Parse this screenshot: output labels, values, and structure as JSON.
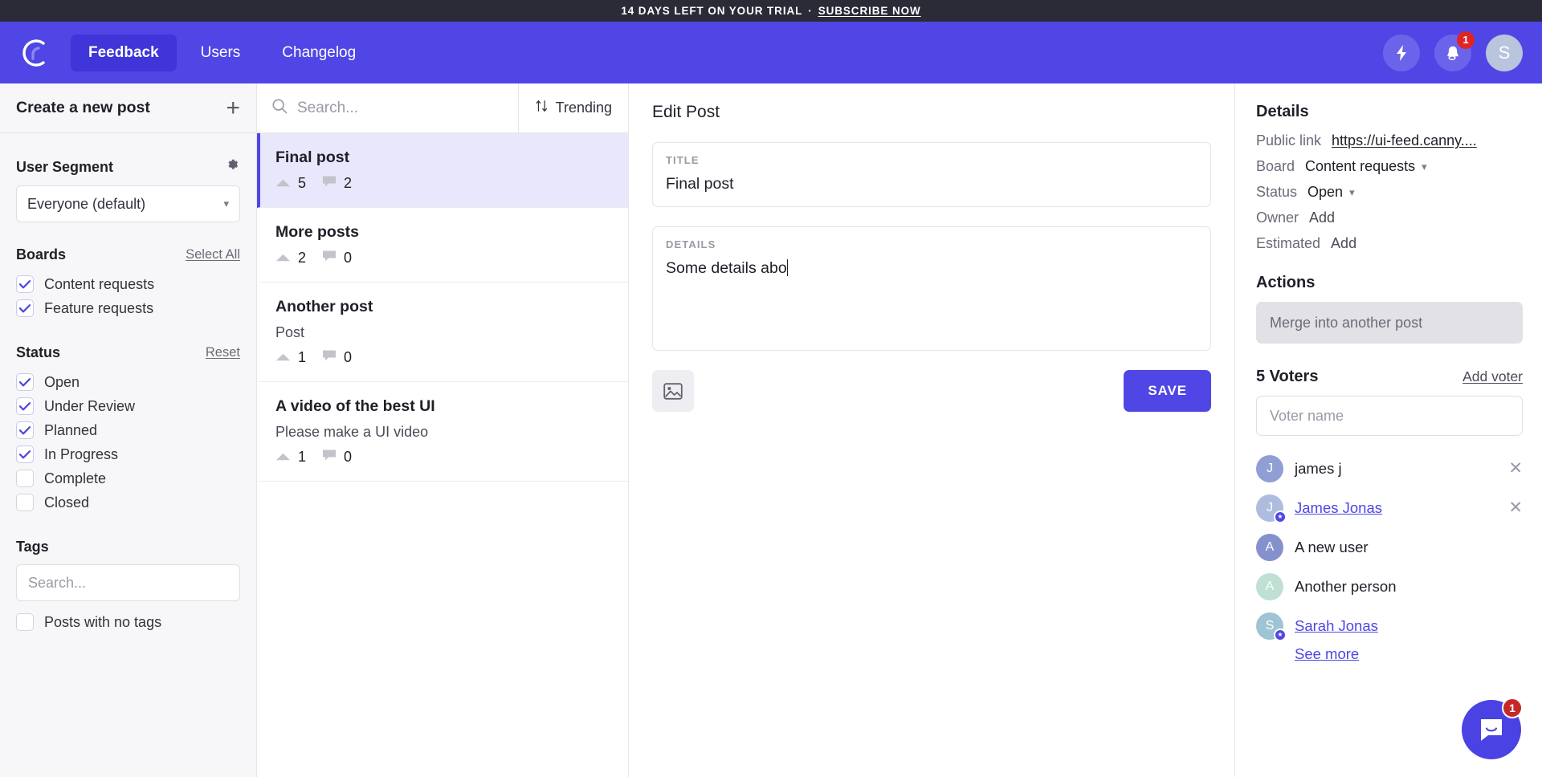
{
  "banner": {
    "text": "14 DAYS LEFT ON YOUR TRIAL",
    "separator": "·",
    "cta": "SUBSCRIBE NOW"
  },
  "topnav": {
    "logo_letter": "C",
    "links": [
      {
        "label": "Feedback",
        "active": true
      },
      {
        "label": "Users",
        "active": false
      },
      {
        "label": "Changelog",
        "active": false
      }
    ],
    "bolt_icon": "bolt-icon",
    "bell_icon": "bell-icon",
    "notification_count": "1",
    "avatar_initial": "S"
  },
  "sidebar": {
    "create_post": "Create a new post",
    "plus_icon": "plus-icon",
    "user_segment": {
      "title": "User Segment",
      "gear_icon": "gear-icon",
      "selected": "Everyone (default)"
    },
    "boards": {
      "title": "Boards",
      "action": "Select All",
      "items": [
        {
          "label": "Content requests",
          "checked": true
        },
        {
          "label": "Feature requests",
          "checked": true
        }
      ]
    },
    "status": {
      "title": "Status",
      "action": "Reset",
      "items": [
        {
          "label": "Open",
          "checked": true
        },
        {
          "label": "Under Review",
          "checked": true
        },
        {
          "label": "Planned",
          "checked": true
        },
        {
          "label": "In Progress",
          "checked": true
        },
        {
          "label": "Complete",
          "checked": false
        },
        {
          "label": "Closed",
          "checked": false
        }
      ]
    },
    "tags": {
      "title": "Tags",
      "search_placeholder": "Search...",
      "no_tags_label": "Posts with no tags",
      "no_tags_checked": false
    }
  },
  "postlist": {
    "search_placeholder": "Search...",
    "search_icon": "search-icon",
    "sort_label": "Trending",
    "sort_icon": "sort-icon",
    "items": [
      {
        "title": "Final post",
        "snippet": "",
        "votes": "5",
        "comments": "2",
        "selected": true
      },
      {
        "title": "More posts",
        "snippet": "",
        "votes": "2",
        "comments": "0",
        "selected": false
      },
      {
        "title": "Another post",
        "snippet": "Post",
        "votes": "1",
        "comments": "0",
        "selected": false
      },
      {
        "title": "A video of the best UI",
        "snippet": "Please make a UI video",
        "votes": "1",
        "comments": "0",
        "selected": false
      }
    ]
  },
  "editor": {
    "heading": "Edit Post",
    "title_label": "TITLE",
    "title_value": "Final post",
    "details_label": "DETAILS",
    "details_value": "Some details abo",
    "image_icon": "image-icon",
    "save_label": "Save"
  },
  "details_panel": {
    "heading": "Details",
    "public_link_key": "Public link",
    "public_link_value": "https://ui-feed.canny....",
    "board_key": "Board",
    "board_value": "Content requests",
    "status_key": "Status",
    "status_value": "Open",
    "owner_key": "Owner",
    "owner_value": "Add",
    "estimated_key": "Estimated",
    "estimated_value": "Add",
    "actions_heading": "Actions",
    "merge_label": "Merge into another post",
    "voters_count_label": "5 Voters",
    "add_voter_label": "Add voter",
    "voter_input_placeholder": "Voter name",
    "voters": [
      {
        "initial": "J",
        "name": "james j",
        "color": "#8f9fd4",
        "linked": false,
        "starred": false,
        "removable": true
      },
      {
        "initial": "J",
        "name": "James Jonas",
        "color": "#adbcdf",
        "linked": true,
        "starred": true,
        "removable": true
      },
      {
        "initial": "A",
        "name": "A new user",
        "color": "#8491cc",
        "linked": false,
        "starred": false,
        "removable": false
      },
      {
        "initial": "A",
        "name": "Another person",
        "color": "#bfe0d2",
        "linked": false,
        "starred": false,
        "removable": false
      },
      {
        "initial": "S",
        "name": "Sarah Jonas",
        "color": "#9fc4d4",
        "linked": true,
        "starred": true,
        "removable": false
      }
    ],
    "see_more_label": "See more"
  },
  "intercom": {
    "icon": "chat-icon",
    "unread": "1"
  },
  "colors": {
    "brand": "#4f46e5",
    "banner_bg": "#2b2b38",
    "selected_row": "#e8e7fb",
    "danger": "#e02424"
  }
}
